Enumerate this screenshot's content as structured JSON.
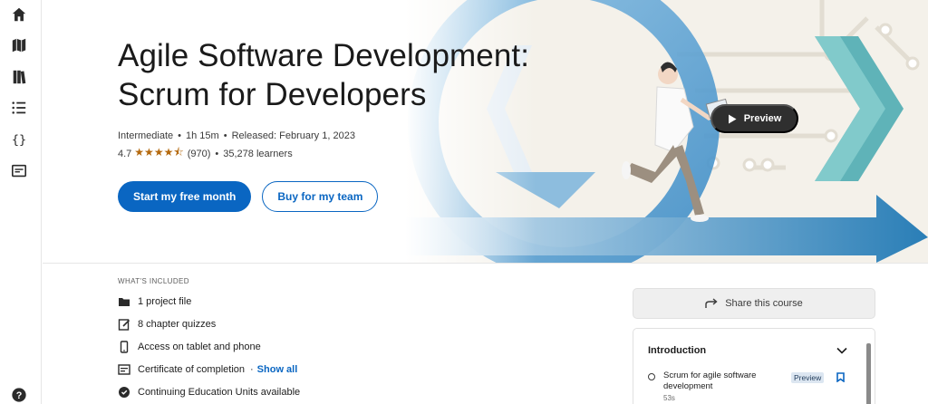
{
  "rail": {
    "icons": [
      "home-icon",
      "map-icon",
      "library-icon",
      "list-icon",
      "code-icon",
      "certificate-icon",
      "help-icon"
    ]
  },
  "course": {
    "title": "Agile Software Development: Scrum for Developers",
    "level": "Intermediate",
    "duration": "1h 15m",
    "released": "Released: February 1, 2023",
    "rating": "4.7",
    "rating_stars": 4.5,
    "reviews": "(970)",
    "learners": "35,278 learners"
  },
  "actions": {
    "primary": "Start my free month",
    "secondary": "Buy for my team",
    "preview": "Preview"
  },
  "included": {
    "heading": "WHAT'S INCLUDED",
    "items": [
      {
        "icon": "folder-icon",
        "label": "1 project file"
      },
      {
        "icon": "quiz-icon",
        "label": "8 chapter quizzes"
      },
      {
        "icon": "phone-icon",
        "label": "Access on tablet and phone"
      },
      {
        "icon": "certificate-icon",
        "label": "Certificate of completion",
        "link": "Show all"
      },
      {
        "icon": "badge-icon",
        "label": "Continuing Education Units available"
      }
    ]
  },
  "share": {
    "label": "Share this course"
  },
  "toc": {
    "section": "Introduction",
    "items": [
      {
        "label": "Scrum for agile software development",
        "duration": "53s",
        "badge": "Preview"
      }
    ]
  },
  "colors": {
    "accent": "#0a66c2",
    "star": "#b4690e",
    "art_teal": "#5fb3b8",
    "art_blue": "#4a90c8"
  }
}
